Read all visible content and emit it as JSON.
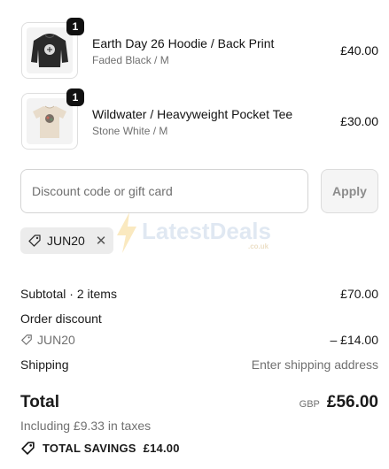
{
  "items": [
    {
      "title": "Earth Day 26 Hoodie / Back Print",
      "variant": "Faded Black / M",
      "price": "£40.00",
      "quantity": "1",
      "image": "black-hoodie"
    },
    {
      "title": "Wildwater / Heavyweight Pocket Tee",
      "variant": "Stone White / M",
      "price": "£30.00",
      "quantity": "1",
      "image": "stone-white-tee"
    }
  ],
  "discount": {
    "placeholder": "Discount code or gift card",
    "apply_label": "Apply",
    "applied_code": "JUN20"
  },
  "watermark": {
    "text": "LatestDeals",
    "sub": ".co.uk"
  },
  "summary": {
    "subtotal_label": "Subtotal · 2 items",
    "subtotal_value": "£70.00",
    "order_discount_label": "Order discount",
    "discount_code": "JUN20",
    "discount_value": "– £14.00",
    "shipping_label": "Shipping",
    "shipping_value": "Enter shipping address",
    "total_label": "Total",
    "currency": "GBP",
    "total_value": "£56.00",
    "taxes": "Including £9.33 in taxes",
    "savings_label": "TOTAL SAVINGS",
    "savings_value": "£14.00"
  },
  "colors": {
    "badge": "#111111",
    "chip": "#ececec",
    "muted": "#707070"
  }
}
